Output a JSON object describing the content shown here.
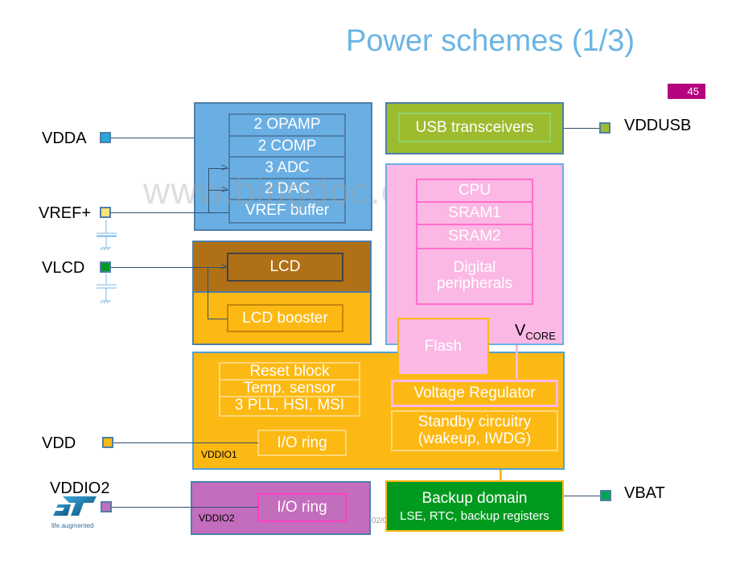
{
  "slide": {
    "title": "Power schemes (1/3)",
    "page_number": "45",
    "watermark": "www.bingdoc.com",
    "footer_date_fragment": "02/0"
  },
  "colors": {
    "title": "#6cb4e4",
    "page_badge": "#b5037d",
    "analog_block": "#6aafe3",
    "usb_block": "#9dbb2e",
    "core_block": "#fbb8e4",
    "lcd_block": "#b07116",
    "vdd_block": "#fdb913",
    "vddio2_block": "#c36dbd",
    "backup_block": "#009a1f"
  },
  "pins": {
    "vdda": "VDDA",
    "vref": "VREF+",
    "vlcd": "VLCD",
    "vdd": "VDD",
    "vddio2": "VDDIO2",
    "vddusb": "VDDUSB",
    "vbat": "VBAT"
  },
  "analog_block": {
    "items": [
      "2 OPAMP",
      "2 COMP",
      "3 ADC",
      "2 DAC",
      "VREF buffer"
    ]
  },
  "lcd_block": {
    "lcd": "LCD",
    "booster": "LCD booster"
  },
  "usb_block": {
    "label": "USB transceivers"
  },
  "core_block": {
    "items": [
      "CPU",
      "SRAM1",
      "SRAM2",
      "Digital peripherals"
    ],
    "flash": "Flash",
    "vcore_main": "V",
    "vcore_sub": "CORE"
  },
  "vdd_block": {
    "items": [
      "Reset block",
      "Temp. sensor",
      "3 PLL, HSI, MSI"
    ],
    "io_ring": "I/O ring",
    "domain_label": "VDDIO1",
    "regulator": "Voltage Regulator",
    "standby_line1": "Standby circuitry",
    "standby_line2": "(wakeup, IWDG)"
  },
  "vddio2_block": {
    "io_ring": "I/O ring",
    "domain_label": "VDDIO2"
  },
  "backup_block": {
    "title": "Backup domain",
    "subtitle": "LSE, RTC, backup registers"
  },
  "logo": {
    "brand": "ST",
    "tagline": "life.augmented"
  }
}
